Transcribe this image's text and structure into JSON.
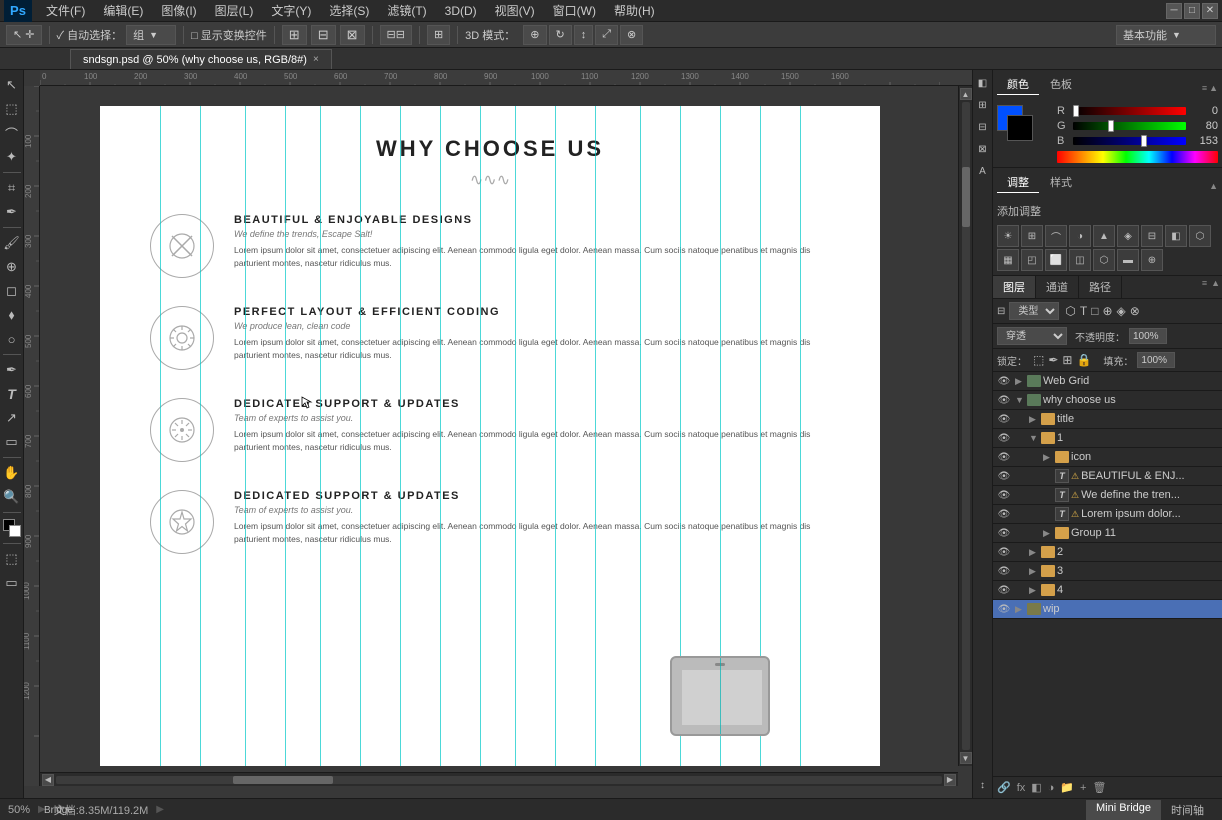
{
  "app": {
    "title": "Adobe Photoshop",
    "logo": "Ps"
  },
  "menu": {
    "items": [
      "文件(F)",
      "编辑(E)",
      "图像(I)",
      "图层(L)",
      "文字(Y)",
      "选择(S)",
      "滤镜(T)",
      "3D(D)",
      "视图(V)",
      "窗口(W)",
      "帮助(H)"
    ]
  },
  "toolbar": {
    "auto_select_label": "✓ 自动选择：",
    "group_label": "组",
    "show_transform_label": "□ 显示变换控件",
    "mode_label": "3D 模式：",
    "workspace_label": "基本功能"
  },
  "tab": {
    "filename": "sndsgn.psd @ 50% (why choose us, RGB/8#)",
    "close": "×"
  },
  "canvas": {
    "zoom": "50%",
    "doc_info": "文档:8.35M/119.2M"
  },
  "document": {
    "title": "WHY CHOOSE US",
    "divider": "∿∿∿",
    "features": [
      {
        "icon": "✕",
        "title": "BEAUTIFUL & ENJOYABLE DESIGNS",
        "subtitle": "We define the trends, Escape Salt!",
        "body": "Lorem ipsum dolor sit amet, consectetuer adipiscing elit. Aenean commodo ligula eget dolor. Aenean massa. Cum sociis natoque penatibus et magnis dis parturient montes, nascetur ridiculus mus."
      },
      {
        "icon": "⚙",
        "title": "PERFECT LAYOUT & EFFICIENT CODING",
        "subtitle": "We produce lean, clean code",
        "body": "Lorem ipsum dolor sit amet, consectetuer adipiscing elit. Aenean commodo ligula eget dolor. Aenean massa. Cum sociis natoque penatibus et magnis dis parturient montes, nascetur ridiculus mus."
      },
      {
        "icon": "✳",
        "title": "DEDICATED SUPPORT & UPDATES",
        "subtitle": "Team of experts to assist you.",
        "body": "Lorem ipsum dolor sit amet, consectetuer adipiscing elit. Aenean commodo ligula eget dolor. Aenean massa. Cum sociis natoque penatibus et magnis dis parturient montes, nascetur ridiculus mus."
      },
      {
        "icon": "★",
        "title": "DEDICATED SUPPORT & UPDATES",
        "subtitle": "Team of experts to assist you.",
        "body": "Lorem ipsum dolor sit amet, consectetuer adipiscing elit. Aenean commodo ligula eget dolor. Aenean massa. Cum sociis natoque penatibus et magnis dis parturient montes, nascetur ridiculus mus."
      }
    ]
  },
  "color_panel": {
    "tab1": "颜色",
    "tab2": "色板",
    "r_value": "0",
    "g_value": "80",
    "b_value": "153",
    "r_pct": 0,
    "g_pct": 31,
    "b_pct": 60
  },
  "adjust_panel": {
    "title": "调整",
    "tab2": "样式",
    "add_label": "添加调整"
  },
  "layers_panel": {
    "tab1": "图层",
    "tab2": "通道",
    "tab3": "路径",
    "filter_label": "类型",
    "blend_mode": "穿透",
    "opacity_label": "不透明度：",
    "opacity_value": "100%",
    "lock_label": "锁定：",
    "fill_label": "填充：",
    "fill_value": "100%",
    "layers": [
      {
        "indent": 0,
        "vis": true,
        "type": "folder",
        "expand": true,
        "name": "Web Grid",
        "active": false
      },
      {
        "indent": 0,
        "vis": true,
        "type": "folder",
        "expand": true,
        "name": "why choose us",
        "active": false
      },
      {
        "indent": 1,
        "vis": true,
        "type": "folder",
        "expand": false,
        "name": "title",
        "active": false
      },
      {
        "indent": 1,
        "vis": true,
        "type": "folder",
        "expand": true,
        "name": "1",
        "active": false
      },
      {
        "indent": 2,
        "vis": true,
        "type": "folder",
        "expand": false,
        "name": "icon",
        "active": false
      },
      {
        "indent": 2,
        "vis": true,
        "type": "text",
        "expand": false,
        "name": "BEAUTIFUL & ENJ...",
        "active": false,
        "warn": true
      },
      {
        "indent": 2,
        "vis": true,
        "type": "text",
        "expand": false,
        "name": "We define the tren...",
        "active": false,
        "warn": true
      },
      {
        "indent": 2,
        "vis": true,
        "type": "text",
        "expand": false,
        "name": "Lorem ipsum dolor...",
        "active": false,
        "warn": true
      },
      {
        "indent": 2,
        "vis": true,
        "type": "folder",
        "expand": false,
        "name": "Group 11",
        "active": false
      },
      {
        "indent": 1,
        "vis": true,
        "type": "folder",
        "expand": false,
        "name": "2",
        "active": false
      },
      {
        "indent": 1,
        "vis": true,
        "type": "folder",
        "expand": false,
        "name": "3",
        "active": false
      },
      {
        "indent": 1,
        "vis": true,
        "type": "folder",
        "expand": false,
        "name": "4",
        "active": false
      },
      {
        "indent": 0,
        "vis": true,
        "type": "folder",
        "expand": false,
        "name": "wip",
        "active": false
      }
    ]
  },
  "status_bar": {
    "zoom": "50%",
    "doc_info": "文档:8.35M/119.2M",
    "tab1": "Mini Bridge",
    "tab2": "时间轴",
    "bridge_label": "Bridge"
  }
}
